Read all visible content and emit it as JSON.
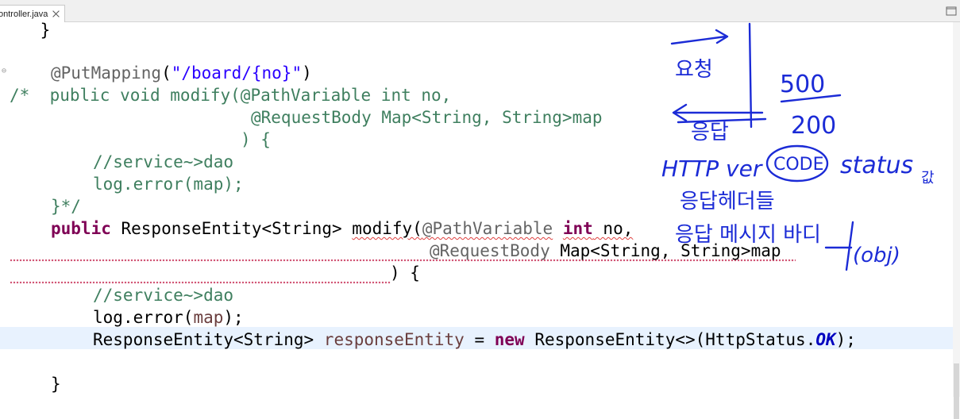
{
  "tab": {
    "filename": "ontroller.java"
  },
  "code": {
    "l1": "    }",
    "l3_annotation": "@PutMapping",
    "l3_string": "\"/board/{no}\"",
    "l4_prefix": "/*  public ",
    "l4_rest": "void modify(@PathVariable int no,",
    "l5": "@RequestBody Map<String, String>map",
    "l6": ") {",
    "l7": "//service~>dao",
    "l8": "log.error(map);",
    "l9": "}*/",
    "l10_kw": "public",
    "l10_type": " ResponseEntity<String> ",
    "l10_method": "modify(",
    "l10_ann": "@PathVariable",
    "l10_kw2": "int",
    "l10_param": " no,",
    "l11_ann": "@RequestBody",
    "l11_rest": " Map<String, String>map",
    "l12": ") {",
    "l13": "//service~>dao",
    "l14_obj": "log",
    "l14_rest": ".error(",
    "l14_arg": "map",
    "l14_end": ");",
    "l15_type": "ResponseEntity<String> ",
    "l15_var": "responseEntity",
    "l15_eq": " = ",
    "l15_new": "new",
    "l15_ctor": " ResponseEntity<>(HttpStatus.",
    "l15_field": "OK",
    "l15_end": ");",
    "l17": "}"
  },
  "annotations": {
    "request": "요청",
    "response": "응답",
    "code_500": "500",
    "code_200": "200",
    "http_ver": "HTTP ver",
    "code": "CODE",
    "status": "status",
    "status_suffix": "값",
    "resp_headers": "응답헤더들",
    "resp_body": "응답 메시지 바디",
    "obj": "(obj)"
  },
  "colors": {
    "keyword": "#7f0055",
    "annotation": "#646464",
    "string": "#2a00ff",
    "comment": "#3f7f5f",
    "ink": "#1b2bd6",
    "current_line": "#e8f2fe"
  }
}
